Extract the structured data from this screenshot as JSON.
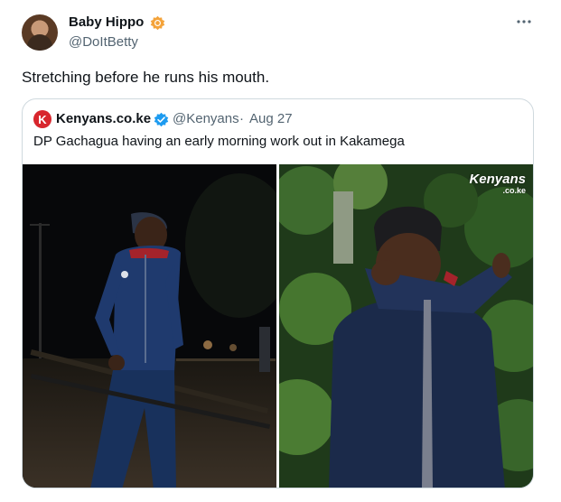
{
  "author": {
    "name": "Baby Hippo",
    "handle": "@DoItBetty",
    "badge_color": "#f4a33a"
  },
  "tweet": {
    "text": "Stretching before he runs his mouth.",
    "more_icon": "more-icon"
  },
  "quote": {
    "name": "Kenyans.co.ke",
    "handle": "@Kenyans",
    "separator": "·",
    "date": "Aug 27",
    "text": "DP Gachagua having an early morning work out in Kakamega",
    "logo_letter": "K",
    "verified_color": "#1d9bf0"
  },
  "media": {
    "watermark_main": "Kenyans",
    "watermark_sub": ".co.ke"
  }
}
